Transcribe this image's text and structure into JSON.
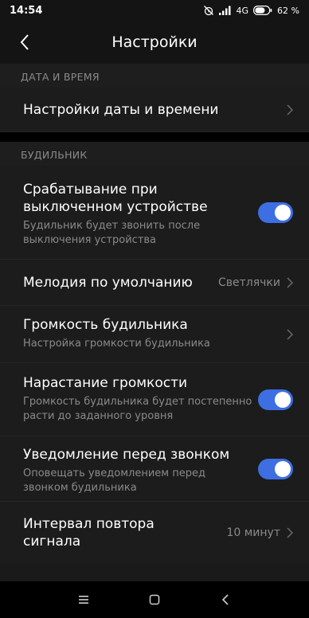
{
  "status": {
    "time": "14:54",
    "network": "4G",
    "battery": "62 %",
    "icons": [
      "alarm-off-icon",
      "signal-icon",
      "battery-icon"
    ]
  },
  "header": {
    "title": "Настройки",
    "back_icon": "chevron-left-icon"
  },
  "sections": {
    "datetime": {
      "header": "ДАТА И ВРЕМЯ",
      "items": [
        {
          "title": "Настройки даты и времени"
        }
      ]
    },
    "alarm": {
      "header": "БУДИЛЬНИК",
      "items": [
        {
          "title": "Срабатывание при выключенном устройстве",
          "subtitle": "Будильник будет звонить после выключения устройства",
          "toggle": "on"
        },
        {
          "title": "Мелодия по умолчанию",
          "value": "Светлячки"
        },
        {
          "title": "Громкость будильника",
          "subtitle": "Настройка громкости будильника"
        },
        {
          "title": "Нарастание громкости",
          "subtitle": "Громкость будильника будет постепенно расти до заданного уровня",
          "toggle": "on"
        },
        {
          "title": "Уведомление перед звонком",
          "subtitle": "Оповещать уведомлением перед звонком будильника",
          "toggle": "on"
        },
        {
          "title": "Интервал повтора сигнала",
          "value": "10 минут"
        }
      ]
    }
  },
  "navbar": {
    "icons": [
      "menu-icon",
      "home-icon",
      "back-icon"
    ]
  },
  "colors": {
    "accent": "#3d6fe3",
    "background": "#1a1a1a",
    "statusbar": "#141414"
  }
}
